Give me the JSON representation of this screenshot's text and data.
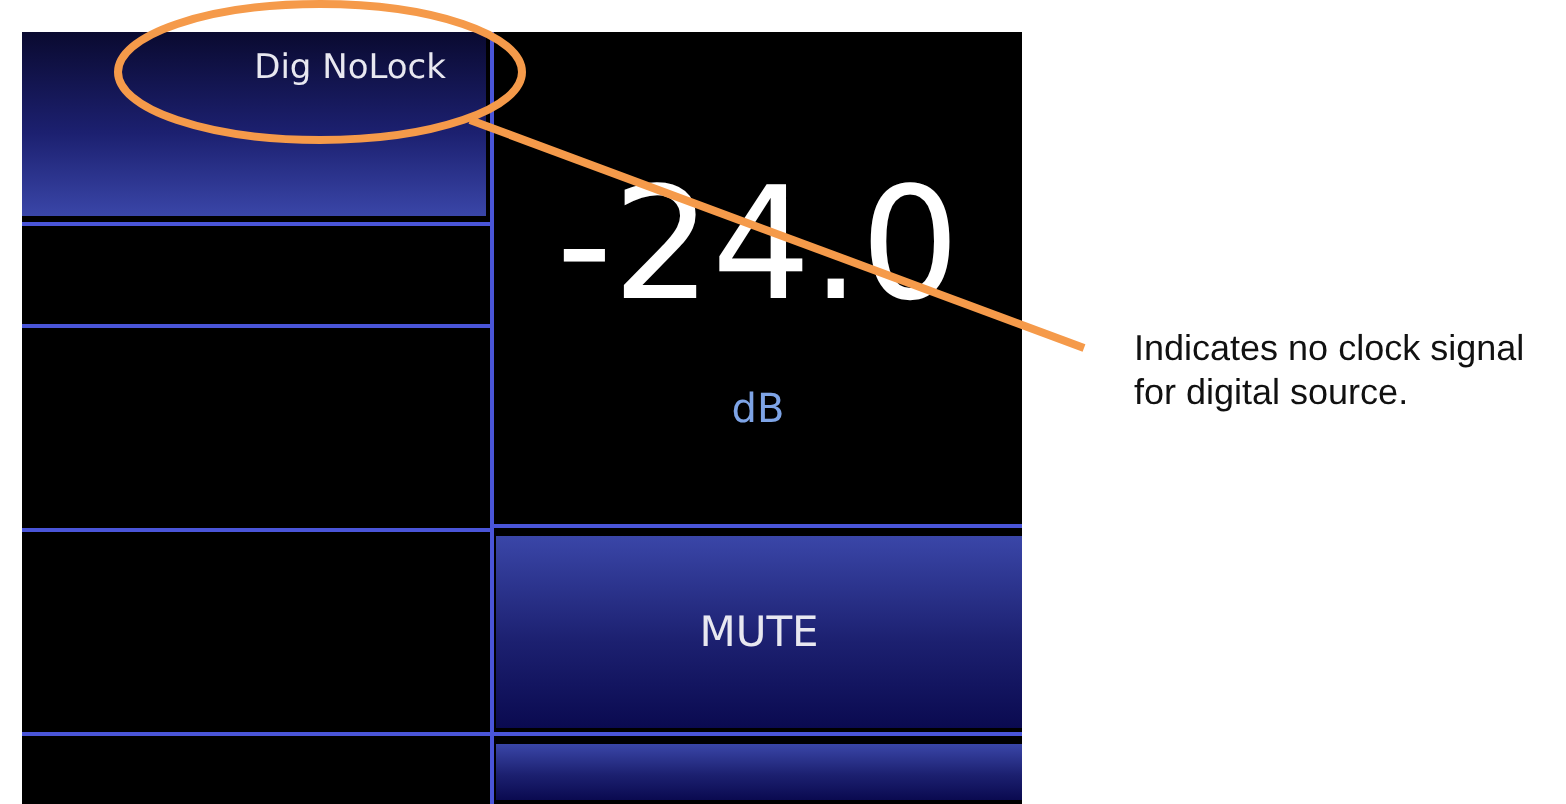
{
  "screen": {
    "status_button": {
      "label": "Dig NoLock"
    },
    "level_readout": {
      "value": "-24.0",
      "unit": "dB"
    },
    "mute_button": {
      "label": "MUTE"
    }
  },
  "annotation": {
    "text": "Indicates no clock signal for digital source."
  }
}
